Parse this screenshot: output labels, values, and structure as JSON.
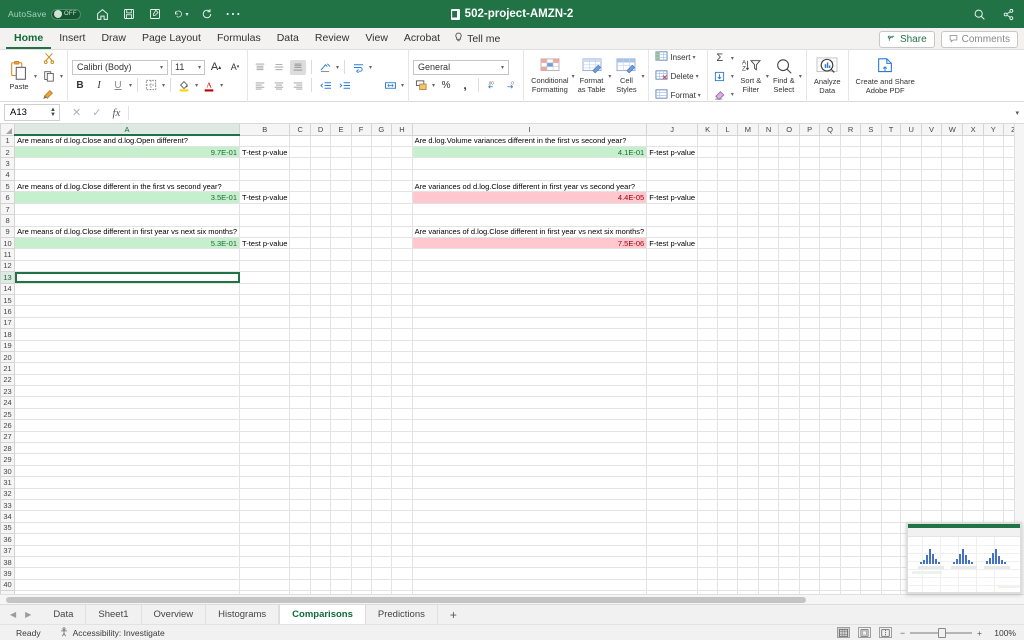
{
  "titlebar": {
    "autosave_label": "AutoSave",
    "autosave_state": "OFF",
    "document_title": "502-project-AMZN-2",
    "icons": [
      "home-icon",
      "save-icon",
      "save-as-icon",
      "undo-icon",
      "redo-icon",
      "more-icon"
    ],
    "right_icons": [
      "search-icon",
      "share-network-icon"
    ],
    "bg_color": "#217346"
  },
  "ribbon_tabs": {
    "items": [
      {
        "label": "Home",
        "active": true
      },
      {
        "label": "Insert",
        "active": false
      },
      {
        "label": "Draw",
        "active": false
      },
      {
        "label": "Page Layout",
        "active": false
      },
      {
        "label": "Formulas",
        "active": false
      },
      {
        "label": "Data",
        "active": false
      },
      {
        "label": "Review",
        "active": false
      },
      {
        "label": "View",
        "active": false
      },
      {
        "label": "Acrobat",
        "active": false
      }
    ],
    "tell_me": "Tell me",
    "share_label": "Share",
    "comments_label": "Comments"
  },
  "ribbon": {
    "paste_label": "Paste",
    "font_name": "Calibri (Body)",
    "font_size": "11",
    "bold": "B",
    "italic": "I",
    "underline": "U",
    "number_format": "General",
    "percent": "%",
    "comma": ",",
    "conditional_formatting": "Conditional\nFormatting",
    "conditional_formatting_l1": "Conditional",
    "conditional_formatting_l2": "Formatting",
    "format_as_table_l1": "Format",
    "format_as_table_l2": "as Table",
    "cell_styles_l1": "Cell",
    "cell_styles_l2": "Styles",
    "insert_label": "Insert",
    "delete_label": "Delete",
    "format_label": "Format",
    "sort_filter_l1": "Sort &",
    "sort_filter_l2": "Filter",
    "find_select_l1": "Find &",
    "find_select_l2": "Select",
    "analyze_data_l1": "Analyze",
    "analyze_data_l2": "Data",
    "adobe_pdf_l1": "Create and Share",
    "adobe_pdf_l2": "Adobe PDF"
  },
  "formula_bar": {
    "name_box": "A13",
    "formula_value": "",
    "cancel_icon": "cancel-icon",
    "confirm_icon": "confirm-icon",
    "fx_label": "fx"
  },
  "grid": {
    "columns": [
      "A",
      "B",
      "C",
      "D",
      "E",
      "F",
      "G",
      "H",
      "I",
      "J",
      "K",
      "L",
      "M",
      "N",
      "O",
      "P",
      "Q",
      "R",
      "S",
      "T",
      "U",
      "V",
      "W",
      "X",
      "Y",
      "Z"
    ],
    "active_cell": "A13",
    "active_cell_row": 13,
    "active_cell_col": "A",
    "rows_visible": 44,
    "cells": [
      {
        "row": 1,
        "col": "A",
        "value": "Are means of d.log.Close and d.log.Open different?",
        "style": "question"
      },
      {
        "row": 1,
        "col": "I",
        "value": "Are d.log.Volume variances different in the first vs second year?",
        "style": "question"
      },
      {
        "row": 2,
        "col": "A",
        "value": "9.7E-01",
        "style": "green"
      },
      {
        "row": 2,
        "col": "B",
        "value": "T-test p-value",
        "style": "label"
      },
      {
        "row": 2,
        "col": "I",
        "value": "4.1E-01",
        "style": "green"
      },
      {
        "row": 2,
        "col": "J",
        "value": "F-test p-value",
        "style": "label"
      },
      {
        "row": 5,
        "col": "A",
        "value": "Are means of d.log.Close different in the first vs second year?",
        "style": "question"
      },
      {
        "row": 5,
        "col": "I",
        "value": "Are variances od d.log.Close different in first year vs second year?",
        "style": "question"
      },
      {
        "row": 6,
        "col": "A",
        "value": "3.5E-01",
        "style": "green"
      },
      {
        "row": 6,
        "col": "B",
        "value": "T-test p-value",
        "style": "label"
      },
      {
        "row": 6,
        "col": "I",
        "value": "4.4E-05",
        "style": "pink"
      },
      {
        "row": 6,
        "col": "J",
        "value": "F-test p-value",
        "style": "label"
      },
      {
        "row": 9,
        "col": "A",
        "value": "Are means of d.log.Close different in first year vs next six months?",
        "style": "question"
      },
      {
        "row": 9,
        "col": "I",
        "value": "Are variances of d.log.Close different in first year vs next six months?",
        "style": "question"
      },
      {
        "row": 10,
        "col": "A",
        "value": "5.3E-01",
        "style": "green"
      },
      {
        "row": 10,
        "col": "B",
        "value": "T-test p-value",
        "style": "label"
      },
      {
        "row": 10,
        "col": "I",
        "value": "7.5E-06",
        "style": "pink"
      },
      {
        "row": 10,
        "col": "J",
        "value": "F-test p-value",
        "style": "label"
      }
    ],
    "colors": {
      "good_fill": "#c6efcd",
      "good_text": "#1c6b33",
      "bad_fill": "#ffc7ce",
      "bad_text": "#9c0006"
    }
  },
  "sheet_tabs": {
    "items": [
      {
        "label": "Data",
        "active": false
      },
      {
        "label": "Sheet1",
        "active": false
      },
      {
        "label": "Overview",
        "active": false
      },
      {
        "label": "Histograms",
        "active": false
      },
      {
        "label": "Comparisons",
        "active": true
      },
      {
        "label": "Predictions",
        "active": false
      }
    ],
    "add_label": "+"
  },
  "status_bar": {
    "ready": "Ready",
    "accessibility": "Accessibility: Investigate",
    "zoom_level": "100%",
    "view_icons": [
      "normal-view-icon",
      "page-layout-view-icon",
      "page-break-view-icon"
    ],
    "zoom_out": "−",
    "zoom_in": "+"
  },
  "thumbnail_preview": {
    "name": "histograms-sheet-preview"
  }
}
